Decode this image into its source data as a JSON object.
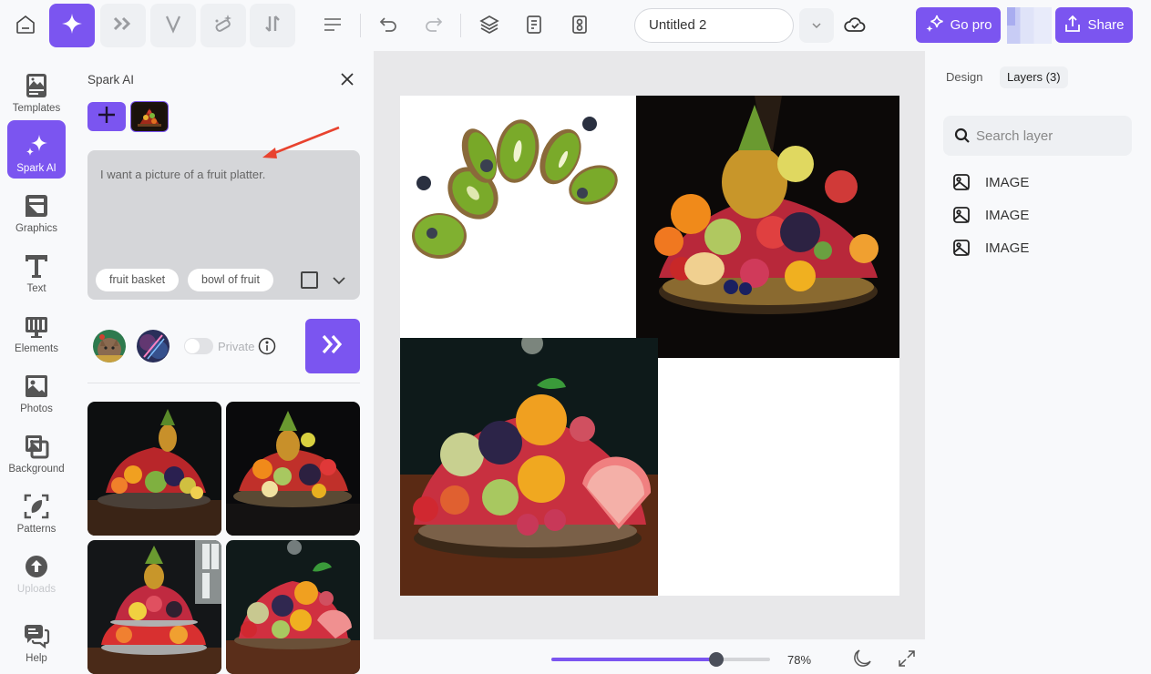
{
  "topbar": {
    "tools": [
      {
        "name": "home",
        "icon": "home-icon"
      },
      {
        "name": "spark",
        "icon": "sparkle-icon",
        "active": true
      },
      {
        "name": "forward",
        "icon": "double-chevron-icon"
      },
      {
        "name": "vector",
        "icon": "v-icon"
      },
      {
        "name": "magic",
        "icon": "magic-eraser-icon"
      },
      {
        "name": "sort",
        "icon": "sort-arrows-icon"
      }
    ],
    "document_title": "Untitled 2",
    "go_pro_label": "Go pro",
    "share_label": "Share"
  },
  "rail": {
    "items": [
      {
        "label": "Templates",
        "icon": "templates-icon"
      },
      {
        "label": "Spark AI",
        "icon": "sparkle-icon",
        "active": true
      },
      {
        "label": "Graphics",
        "icon": "graphics-icon"
      },
      {
        "label": "Text",
        "icon": "text-icon"
      },
      {
        "label": "Elements",
        "icon": "elements-icon"
      },
      {
        "label": "Photos",
        "icon": "photos-icon"
      },
      {
        "label": "Background",
        "icon": "background-icon"
      },
      {
        "label": "Patterns",
        "icon": "patterns-icon"
      },
      {
        "label": "Uploads",
        "icon": "upload-icon",
        "disabled": true
      },
      {
        "label": "Help",
        "icon": "help-chat-icon"
      }
    ]
  },
  "spark_panel": {
    "title": "Spark AI",
    "prompt": "I want a picture of a fruit platter.",
    "suggestions": [
      "fruit basket",
      "bowl of fruit"
    ],
    "private_label": "Private",
    "private_enabled": false,
    "results_count": 4
  },
  "canvas": {
    "zoom_level": "78%",
    "zoom_fraction": 0.78
  },
  "right_panel": {
    "tabs": [
      {
        "label": "Design",
        "active": false
      },
      {
        "label": "Layers (3)",
        "active": true
      }
    ],
    "search_placeholder": "Search layer",
    "layers": [
      {
        "label": "IMAGE",
        "icon": "image-icon"
      },
      {
        "label": "IMAGE",
        "icon": "image-icon"
      },
      {
        "label": "IMAGE",
        "icon": "image-icon"
      }
    ]
  },
  "colors": {
    "accent": "#7b55f0",
    "annotation_arrow": "#e8432f"
  }
}
